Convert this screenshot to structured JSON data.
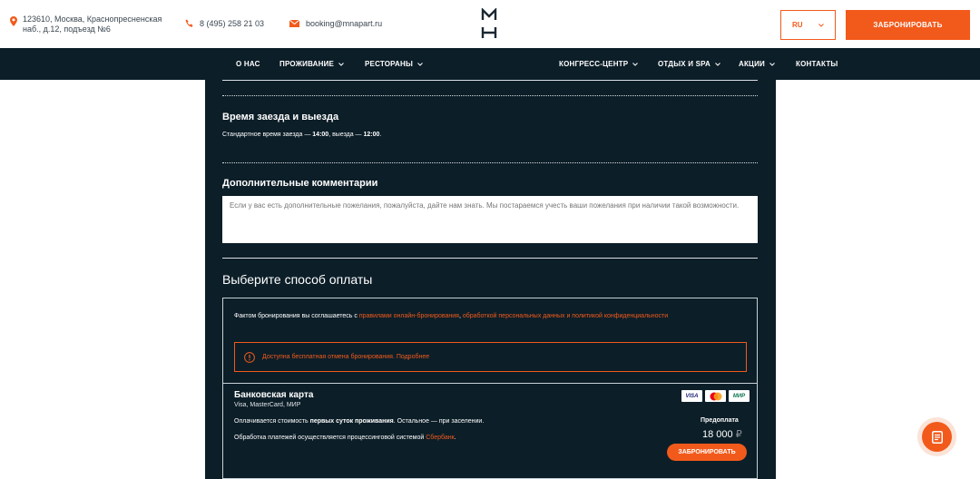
{
  "header": {
    "address_line1": "123610, Москва, Краснопресненская",
    "address_line2": "наб., д.12, подъезд №6",
    "phone": "8 (495) 258 21 03",
    "email": "booking@mnapart.ru",
    "language": "RU",
    "book_button": "ЗАБРОНИРОВАТЬ",
    "accent_color": "#f25a1b",
    "logo_icon": "mh-logo-icon"
  },
  "nav": {
    "items": [
      {
        "label": "О НАС"
      },
      {
        "label": "ПРОЖИВАНИЕ"
      },
      {
        "label": "РЕСТОРАНЫ"
      },
      {
        "label": "КОНГРЕСС-ЦЕНТР"
      },
      {
        "label": "ОТДЫХ И SPA"
      },
      {
        "label": "АКЦИИ"
      },
      {
        "label": "КОНТАКТЫ"
      }
    ]
  },
  "checkin": {
    "title": "Время заезда и выезда",
    "text_prefix": "Стандартное время заезда — ",
    "checkin_time": "14:00",
    "text_middle": ", выезда — ",
    "checkout_time": "12:00",
    "text_suffix": "."
  },
  "comments": {
    "title": "Дополнительные комментарии",
    "placeholder": "Если у вас есть дополнительные пожелания, пожалуйста, дайте нам знать. Мы постараемся учесть ваши пожелания при наличии такой возможности."
  },
  "payment": {
    "title": "Выберите способ оплаты",
    "agree_prefix": "Фактом бронирования вы соглашаетесь с ",
    "agree_link1": "правилами онлайн-бронирования",
    "agree_sep": ", ",
    "agree_link2": "обработкой персональных данных и политикой конфиденциальности",
    "notice": "Доступна бесплатная отмена бронирования. Подробнее",
    "card": {
      "title": "Банковская карта",
      "subtitle": "Visa, MasterCard, МИР",
      "line1_prefix": "Оплачивается стоимость ",
      "line1_bold": "первых суток проживания",
      "line1_suffix": ". Остальное — при заселении.",
      "line2_prefix": "Обработка платежей осуществляется процессинговой системой ",
      "line2_link": "Сбербанк",
      "line2_suffix": ".",
      "logos": [
        "VISA",
        "mastercard",
        "МИР"
      ],
      "prepay_label": "Предоплата",
      "prepay_amount": "18 000",
      "currency": "₽",
      "book_button": "ЗАБРОНИРОВАТЬ"
    }
  }
}
